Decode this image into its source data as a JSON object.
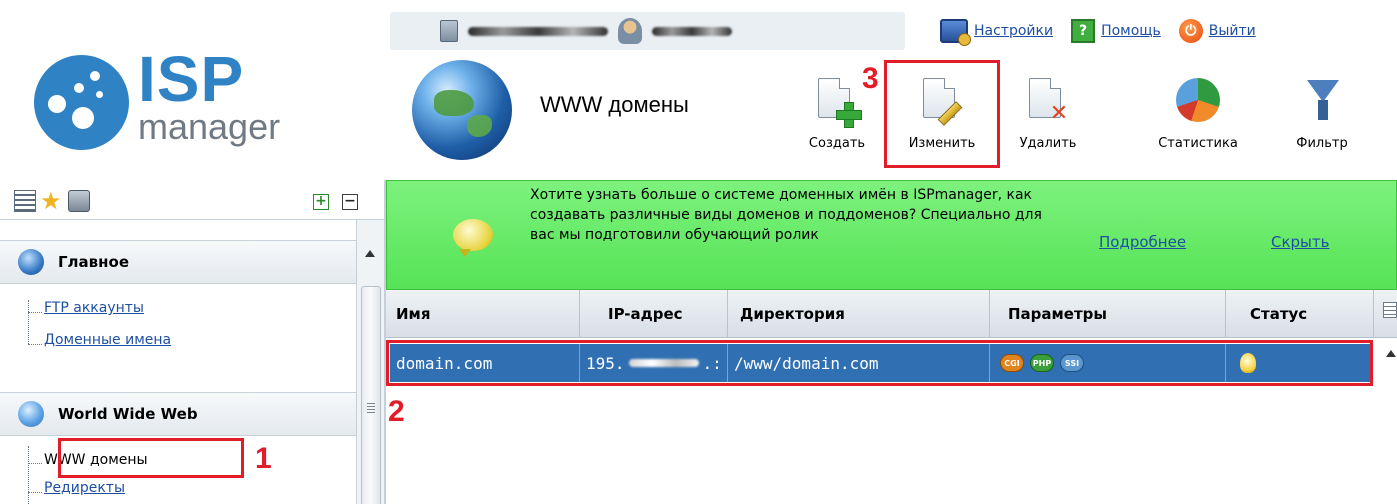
{
  "header": {
    "links": [
      {
        "label": "Настройки",
        "icon": "settings-icon"
      },
      {
        "label": "Помощь",
        "icon": "help-icon"
      },
      {
        "label": "Выйти",
        "icon": "power-icon"
      }
    ]
  },
  "logo": {
    "brand": "ISP",
    "product": "manager"
  },
  "page": {
    "title": "WWW домены"
  },
  "toolbar": {
    "create": "Создать",
    "edit": "Изменить",
    "delete": "Удалить",
    "stats": "Статистика",
    "filter": "Фильтр"
  },
  "annotations": {
    "one": "1",
    "two": "2",
    "three": "3",
    "color": "#e11d2a"
  },
  "sidebar": {
    "groups": [
      {
        "title": "Главное",
        "items": [
          "FTP аккаунты",
          "Доменные имена"
        ]
      },
      {
        "title": "World Wide Web",
        "items": [
          "WWW домены",
          "Редиректы"
        ]
      }
    ]
  },
  "banner": {
    "text": "Хотите узнать больше о системе доменных имён в ISPmanager, как создавать различные виды доменов и поддоменов? Специально для вас мы подготовили обучающий ролик",
    "more": "Подробнее",
    "hide": "Скрыть",
    "color": "#5ee95e"
  },
  "table": {
    "columns": [
      "Имя",
      "IP-адрес",
      "Директория",
      "Параметры",
      "Статус"
    ],
    "rows": [
      {
        "name": "domain.com",
        "ip_prefix": "195.",
        "ip_suffix": ".:",
        "directory": "/www/domain.com",
        "params": [
          "CGI",
          "PHP",
          "SSI"
        ],
        "status_icon": "lightbulb-icon"
      }
    ],
    "selected_color": "#2f6fb2"
  }
}
